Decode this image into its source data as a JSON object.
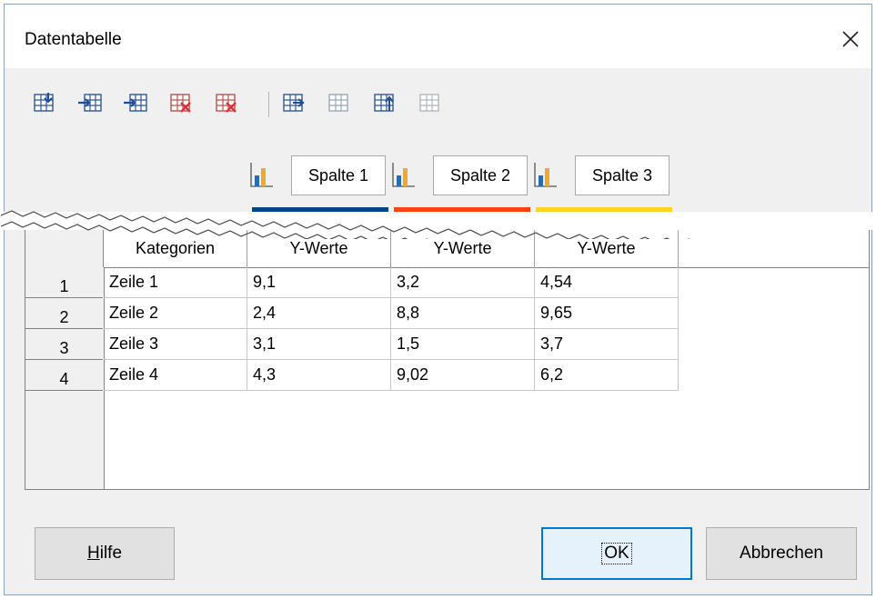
{
  "dialog": {
    "title": "Datentabelle",
    "close_icon": "close-icon"
  },
  "toolbar": {
    "icons": [
      "insert-row-icon",
      "insert-series-icon",
      "insert-text-column-icon",
      "delete-row-icon",
      "delete-series-icon",
      "move-series-right-icon",
      "move-series-left-icon",
      "move-row-up-icon",
      "move-row-down-icon"
    ]
  },
  "series": [
    {
      "name": "Spalte 1",
      "color": "#004586",
      "icon": "chart-type-icon"
    },
    {
      "name": "Spalte 2",
      "color": "#ff420e",
      "icon": "chart-type-icon"
    },
    {
      "name": "Spalte 3",
      "color": "#ffd320",
      "icon": "chart-type-icon"
    }
  ],
  "table": {
    "headers": [
      "Kategorien",
      "Y-Werte",
      "Y-Werte",
      "Y-Werte"
    ],
    "rows": [
      {
        "num": "1",
        "cells": [
          "Zeile 1",
          "9,1",
          "3,2",
          "4,54"
        ]
      },
      {
        "num": "2",
        "cells": [
          "Zeile 2",
          "2,4",
          "8,8",
          "9,65"
        ]
      },
      {
        "num": "3",
        "cells": [
          "Zeile 3",
          "3,1",
          "1,5",
          "3,7"
        ]
      },
      {
        "num": "4",
        "cells": [
          "Zeile 4",
          "4,3",
          "9,02",
          "6,2"
        ]
      }
    ]
  },
  "buttons": {
    "help": {
      "label_underlined": "H",
      "label_rest": "ilfe"
    },
    "ok": "OK",
    "cancel": "Abbrechen"
  }
}
